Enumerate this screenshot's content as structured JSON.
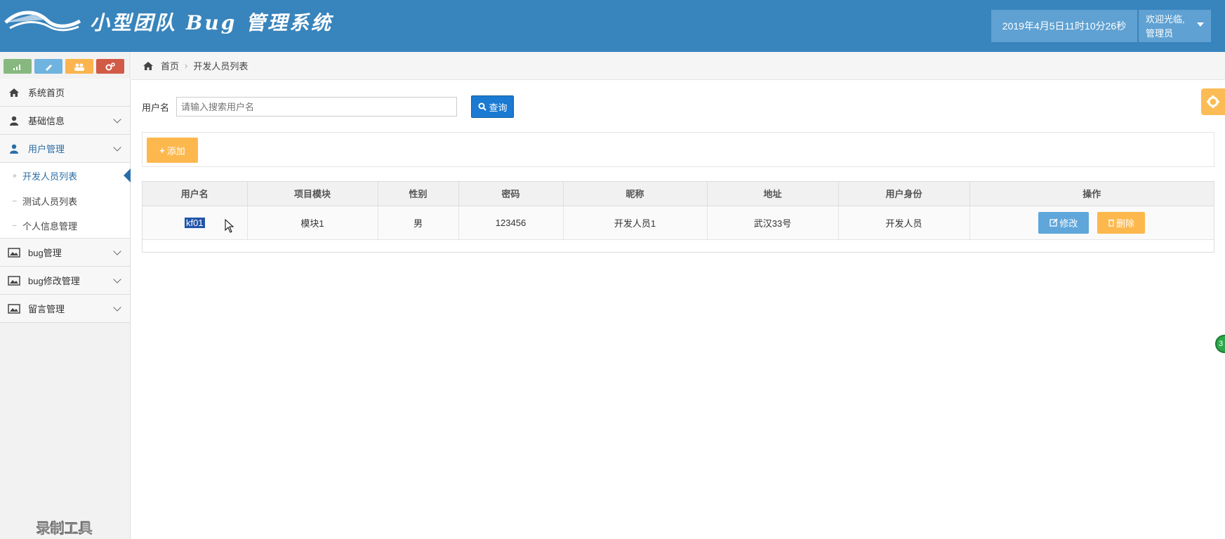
{
  "header": {
    "title": "小型团队 Bug 管理系统",
    "datetime": "2019年4月5日11时10分26秒",
    "welcome": "欢迎光临,",
    "role": "管理员",
    "bg_color": "#3884bc"
  },
  "sidebar": {
    "shortcuts": [
      {
        "icon": "signal-icon",
        "color": "#87b87f"
      },
      {
        "icon": "pencil-icon",
        "color": "#6fb3e0"
      },
      {
        "icon": "users-icon",
        "color": "#fbb44e"
      },
      {
        "icon": "cogs-icon",
        "color": "#d15b47"
      }
    ],
    "items": [
      {
        "label": "系统首页",
        "icon": "home-icon"
      },
      {
        "label": "基础信息",
        "icon": "user-icon"
      },
      {
        "label": "用户管理",
        "icon": "user-icon"
      },
      {
        "label": "bug管理",
        "icon": "picture-icon"
      },
      {
        "label": "bug修改管理",
        "icon": "picture-icon"
      },
      {
        "label": "留言管理",
        "icon": "picture-icon"
      }
    ],
    "sub_items": [
      "开发人员列表",
      "测试人员列表",
      "个人信息管理"
    ],
    "watermark": "录制工具"
  },
  "breadcrumb": {
    "home": "首页",
    "current": "开发人员列表"
  },
  "search": {
    "label": "用户名",
    "placeholder": "请输入搜索用户名",
    "button": "查询"
  },
  "toolbar": {
    "add_label": "添加"
  },
  "table": {
    "columns": [
      "用户名",
      "项目模块",
      "性别",
      "密码",
      "昵称",
      "地址",
      "用户身份",
      "操作"
    ],
    "rows": [
      [
        "kf01",
        "模块1",
        "男",
        "123456",
        "开发人员1",
        "武汉33号",
        "开发人员"
      ]
    ],
    "edit_label": "修改",
    "delete_label": "删除"
  },
  "float": {
    "badge": "3"
  }
}
